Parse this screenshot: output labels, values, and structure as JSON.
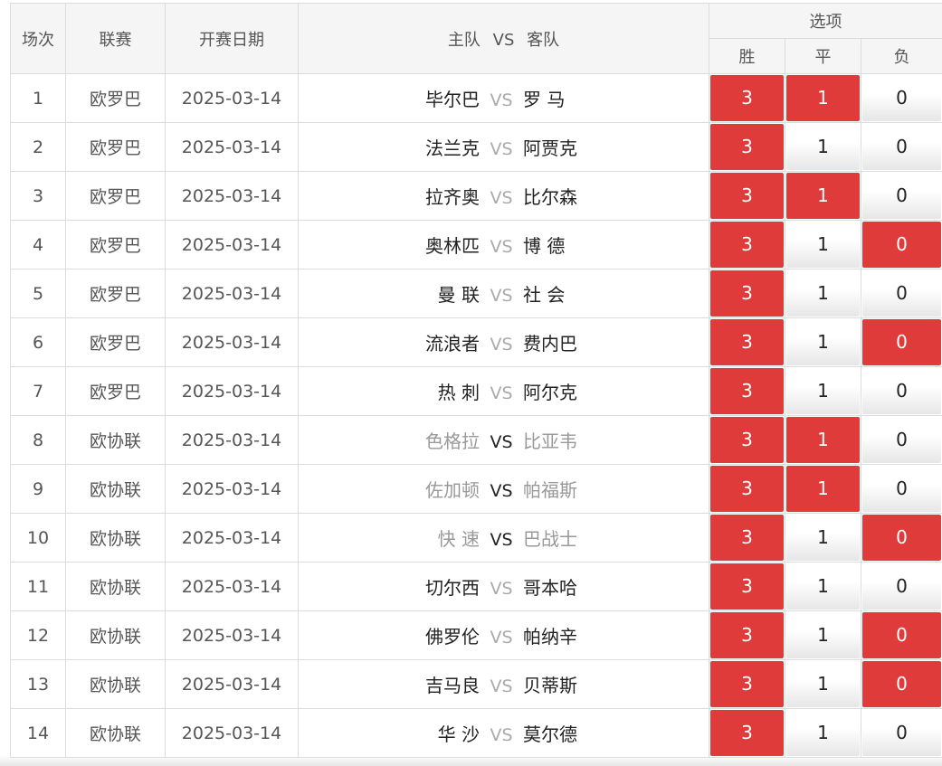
{
  "headers": {
    "match_no": "场次",
    "league": "联赛",
    "date": "开赛日期",
    "home": "主队",
    "vs": "VS",
    "away": "客队",
    "options": "选项",
    "win": "胜",
    "draw": "平",
    "lose": "负"
  },
  "colors": {
    "selected": "#e03b3b",
    "unselected": "#f0f0f0"
  },
  "rows": [
    {
      "no": "1",
      "league": "欧罗巴",
      "date": "2025-03-14",
      "home": "毕尔巴",
      "away": "罗 马",
      "style": "dark",
      "win": "3",
      "draw": "1",
      "lose": "0",
      "sel": [
        true,
        true,
        false
      ]
    },
    {
      "no": "2",
      "league": "欧罗巴",
      "date": "2025-03-14",
      "home": "法兰克",
      "away": "阿贾克",
      "style": "dark",
      "win": "3",
      "draw": "1",
      "lose": "0",
      "sel": [
        true,
        false,
        false
      ]
    },
    {
      "no": "3",
      "league": "欧罗巴",
      "date": "2025-03-14",
      "home": "拉齐奥",
      "away": "比尔森",
      "style": "dark",
      "win": "3",
      "draw": "1",
      "lose": "0",
      "sel": [
        true,
        true,
        false
      ]
    },
    {
      "no": "4",
      "league": "欧罗巴",
      "date": "2025-03-14",
      "home": "奥林匹",
      "away": "博 德",
      "style": "dark",
      "win": "3",
      "draw": "1",
      "lose": "0",
      "sel": [
        true,
        false,
        true
      ]
    },
    {
      "no": "5",
      "league": "欧罗巴",
      "date": "2025-03-14",
      "home": "曼 联",
      "away": "社 会",
      "style": "dark",
      "win": "3",
      "draw": "1",
      "lose": "0",
      "sel": [
        true,
        false,
        false
      ]
    },
    {
      "no": "6",
      "league": "欧罗巴",
      "date": "2025-03-14",
      "home": "流浪者",
      "away": "费内巴",
      "style": "dark",
      "win": "3",
      "draw": "1",
      "lose": "0",
      "sel": [
        true,
        false,
        true
      ]
    },
    {
      "no": "7",
      "league": "欧罗巴",
      "date": "2025-03-14",
      "home": "热 刺",
      "away": "阿尔克",
      "style": "dark",
      "win": "3",
      "draw": "1",
      "lose": "0",
      "sel": [
        true,
        false,
        false
      ]
    },
    {
      "no": "8",
      "league": "欧协联",
      "date": "2025-03-14",
      "home": "色格拉",
      "away": "比亚韦",
      "style": "grey",
      "win": "3",
      "draw": "1",
      "lose": "0",
      "sel": [
        true,
        true,
        false
      ]
    },
    {
      "no": "9",
      "league": "欧协联",
      "date": "2025-03-14",
      "home": "佐加顿",
      "away": "帕福斯",
      "style": "grey",
      "win": "3",
      "draw": "1",
      "lose": "0",
      "sel": [
        true,
        true,
        false
      ]
    },
    {
      "no": "10",
      "league": "欧协联",
      "date": "2025-03-14",
      "home": "快 速",
      "away": "巴战士",
      "style": "grey",
      "win": "3",
      "draw": "1",
      "lose": "0",
      "sel": [
        true,
        false,
        true
      ]
    },
    {
      "no": "11",
      "league": "欧协联",
      "date": "2025-03-14",
      "home": "切尔西",
      "away": "哥本哈",
      "style": "dark",
      "win": "3",
      "draw": "1",
      "lose": "0",
      "sel": [
        true,
        false,
        false
      ]
    },
    {
      "no": "12",
      "league": "欧协联",
      "date": "2025-03-14",
      "home": "佛罗伦",
      "away": "帕纳辛",
      "style": "dark",
      "win": "3",
      "draw": "1",
      "lose": "0",
      "sel": [
        true,
        false,
        true
      ]
    },
    {
      "no": "13",
      "league": "欧协联",
      "date": "2025-03-14",
      "home": "吉马良",
      "away": "贝蒂斯",
      "style": "dark",
      "win": "3",
      "draw": "1",
      "lose": "0",
      "sel": [
        true,
        false,
        true
      ]
    },
    {
      "no": "14",
      "league": "欧协联",
      "date": "2025-03-14",
      "home": "华 沙",
      "away": "莫尔德",
      "style": "dark",
      "win": "3",
      "draw": "1",
      "lose": "0",
      "sel": [
        true,
        false,
        false
      ]
    }
  ]
}
